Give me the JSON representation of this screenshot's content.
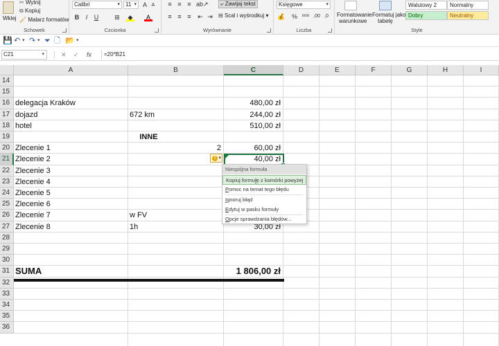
{
  "ribbon": {
    "clipboard": {
      "paste_label": "Wklej",
      "cut_label": "Wytnij",
      "copy_label": "Kopiuj",
      "painter_label": "Malarz formatów",
      "group_label": "Schowek"
    },
    "font": {
      "font_name": "Calibri",
      "font_size": "11",
      "group_label": "Czcionka"
    },
    "alignment": {
      "wrap_label": "Zawijaj tekst",
      "merge_label": "Scal i wyśrodkuj",
      "group_label": "Wyrównanie"
    },
    "number": {
      "format_value": "Księgowe",
      "group_label": "Liczba"
    },
    "styles": {
      "conditional_label_1": "Formatowanie",
      "conditional_label_2": "warunkowe",
      "table_label_1": "Formatuj jako",
      "table_label_2": "tabelę",
      "style_currency": "Walutowy 2",
      "style_normal": "Normalny",
      "style_good": "Dobry",
      "style_neutral": "Neutralny",
      "group_label": "Style",
      "good_bg": "#c6efce",
      "good_fg": "#006100",
      "neutral_bg": "#ffeb9c",
      "neutral_fg": "#9c5700"
    }
  },
  "formula_bar": {
    "name_box": "C21",
    "cancel_icon": "✕",
    "enter_icon": "✓",
    "fx": "fx",
    "formula": "=20*B21"
  },
  "sheet": {
    "columns": [
      "A",
      "B",
      "C",
      "D",
      "E",
      "F",
      "G",
      "H",
      "I"
    ],
    "selected_column": "C",
    "selected_row": "21",
    "rows": [
      {
        "num": "14",
        "a": "",
        "b": "",
        "c": ""
      },
      {
        "num": "15",
        "a": "",
        "b": "",
        "c": ""
      },
      {
        "num": "16",
        "a": "delegacja Kraków",
        "b": "",
        "c": "480,00 zł"
      },
      {
        "num": "17",
        "a": "dojazd",
        "b": "672 km",
        "c": "244,00 zł"
      },
      {
        "num": "18",
        "a": "hotel",
        "b": "",
        "c": "510,00 zł"
      },
      {
        "num": "19",
        "a": "",
        "b": "",
        "c": "",
        "merged": "INNE"
      },
      {
        "num": "20",
        "a": "Zlecenie 1",
        "b": "2",
        "c": "60,00 zł"
      },
      {
        "num": "21",
        "a": "Zlecenie 2",
        "b": "",
        "c": "40,00 zł"
      },
      {
        "num": "22",
        "a": "Zlecenie 3",
        "b": "",
        "c": ""
      },
      {
        "num": "23",
        "a": "Zlecenie 4",
        "b": "",
        "c": ""
      },
      {
        "num": "24",
        "a": "Zlecenie 5",
        "b": "",
        "c": ""
      },
      {
        "num": "25",
        "a": "Zlecenie 6",
        "b": "",
        "c": ""
      },
      {
        "num": "26",
        "a": "Zlecenie 7",
        "b": "w FV",
        "c": ""
      },
      {
        "num": "27",
        "a": "Zlecenie 8",
        "b": "1h",
        "c": "30,00 zł"
      },
      {
        "num": "28",
        "a": "",
        "b": "",
        "c": ""
      },
      {
        "num": "29",
        "a": "",
        "b": "",
        "c": ""
      },
      {
        "num": "30",
        "a": "",
        "b": "",
        "c": ""
      },
      {
        "num": "31",
        "a": "SUMA",
        "b": "",
        "c": "1 806,00 zł"
      },
      {
        "num": "32",
        "a": "",
        "b": "",
        "c": ""
      },
      {
        "num": "33",
        "a": "",
        "b": "",
        "c": ""
      },
      {
        "num": "34",
        "a": "",
        "b": "",
        "c": ""
      },
      {
        "num": "35",
        "a": "",
        "b": "",
        "c": ""
      },
      {
        "num": "36",
        "a": "",
        "b": "",
        "c": ""
      }
    ]
  },
  "error_menu": {
    "items": [
      {
        "label": "Niespójna formuła",
        "pre": "",
        "u": "",
        "post": ""
      },
      {
        "label": "",
        "pre": "Kopiuj formu",
        "u": "ł",
        "post": "ę z komórki powyżej"
      },
      {
        "label": "",
        "pre": "",
        "u": "P",
        "post": "omoc na temat tego błędu"
      },
      {
        "label": "",
        "pre": "",
        "u": "I",
        "post": "gnoruj błąd"
      },
      {
        "label": "",
        "pre": "",
        "u": "E",
        "post": "dytuj w pasku formuły"
      },
      {
        "label": "",
        "pre": "",
        "u": "O",
        "post": "pcje sprawdzania błędów..."
      }
    ]
  },
  "colors": {
    "accent": "#217346",
    "error_triangle": "#1b7a3e"
  }
}
